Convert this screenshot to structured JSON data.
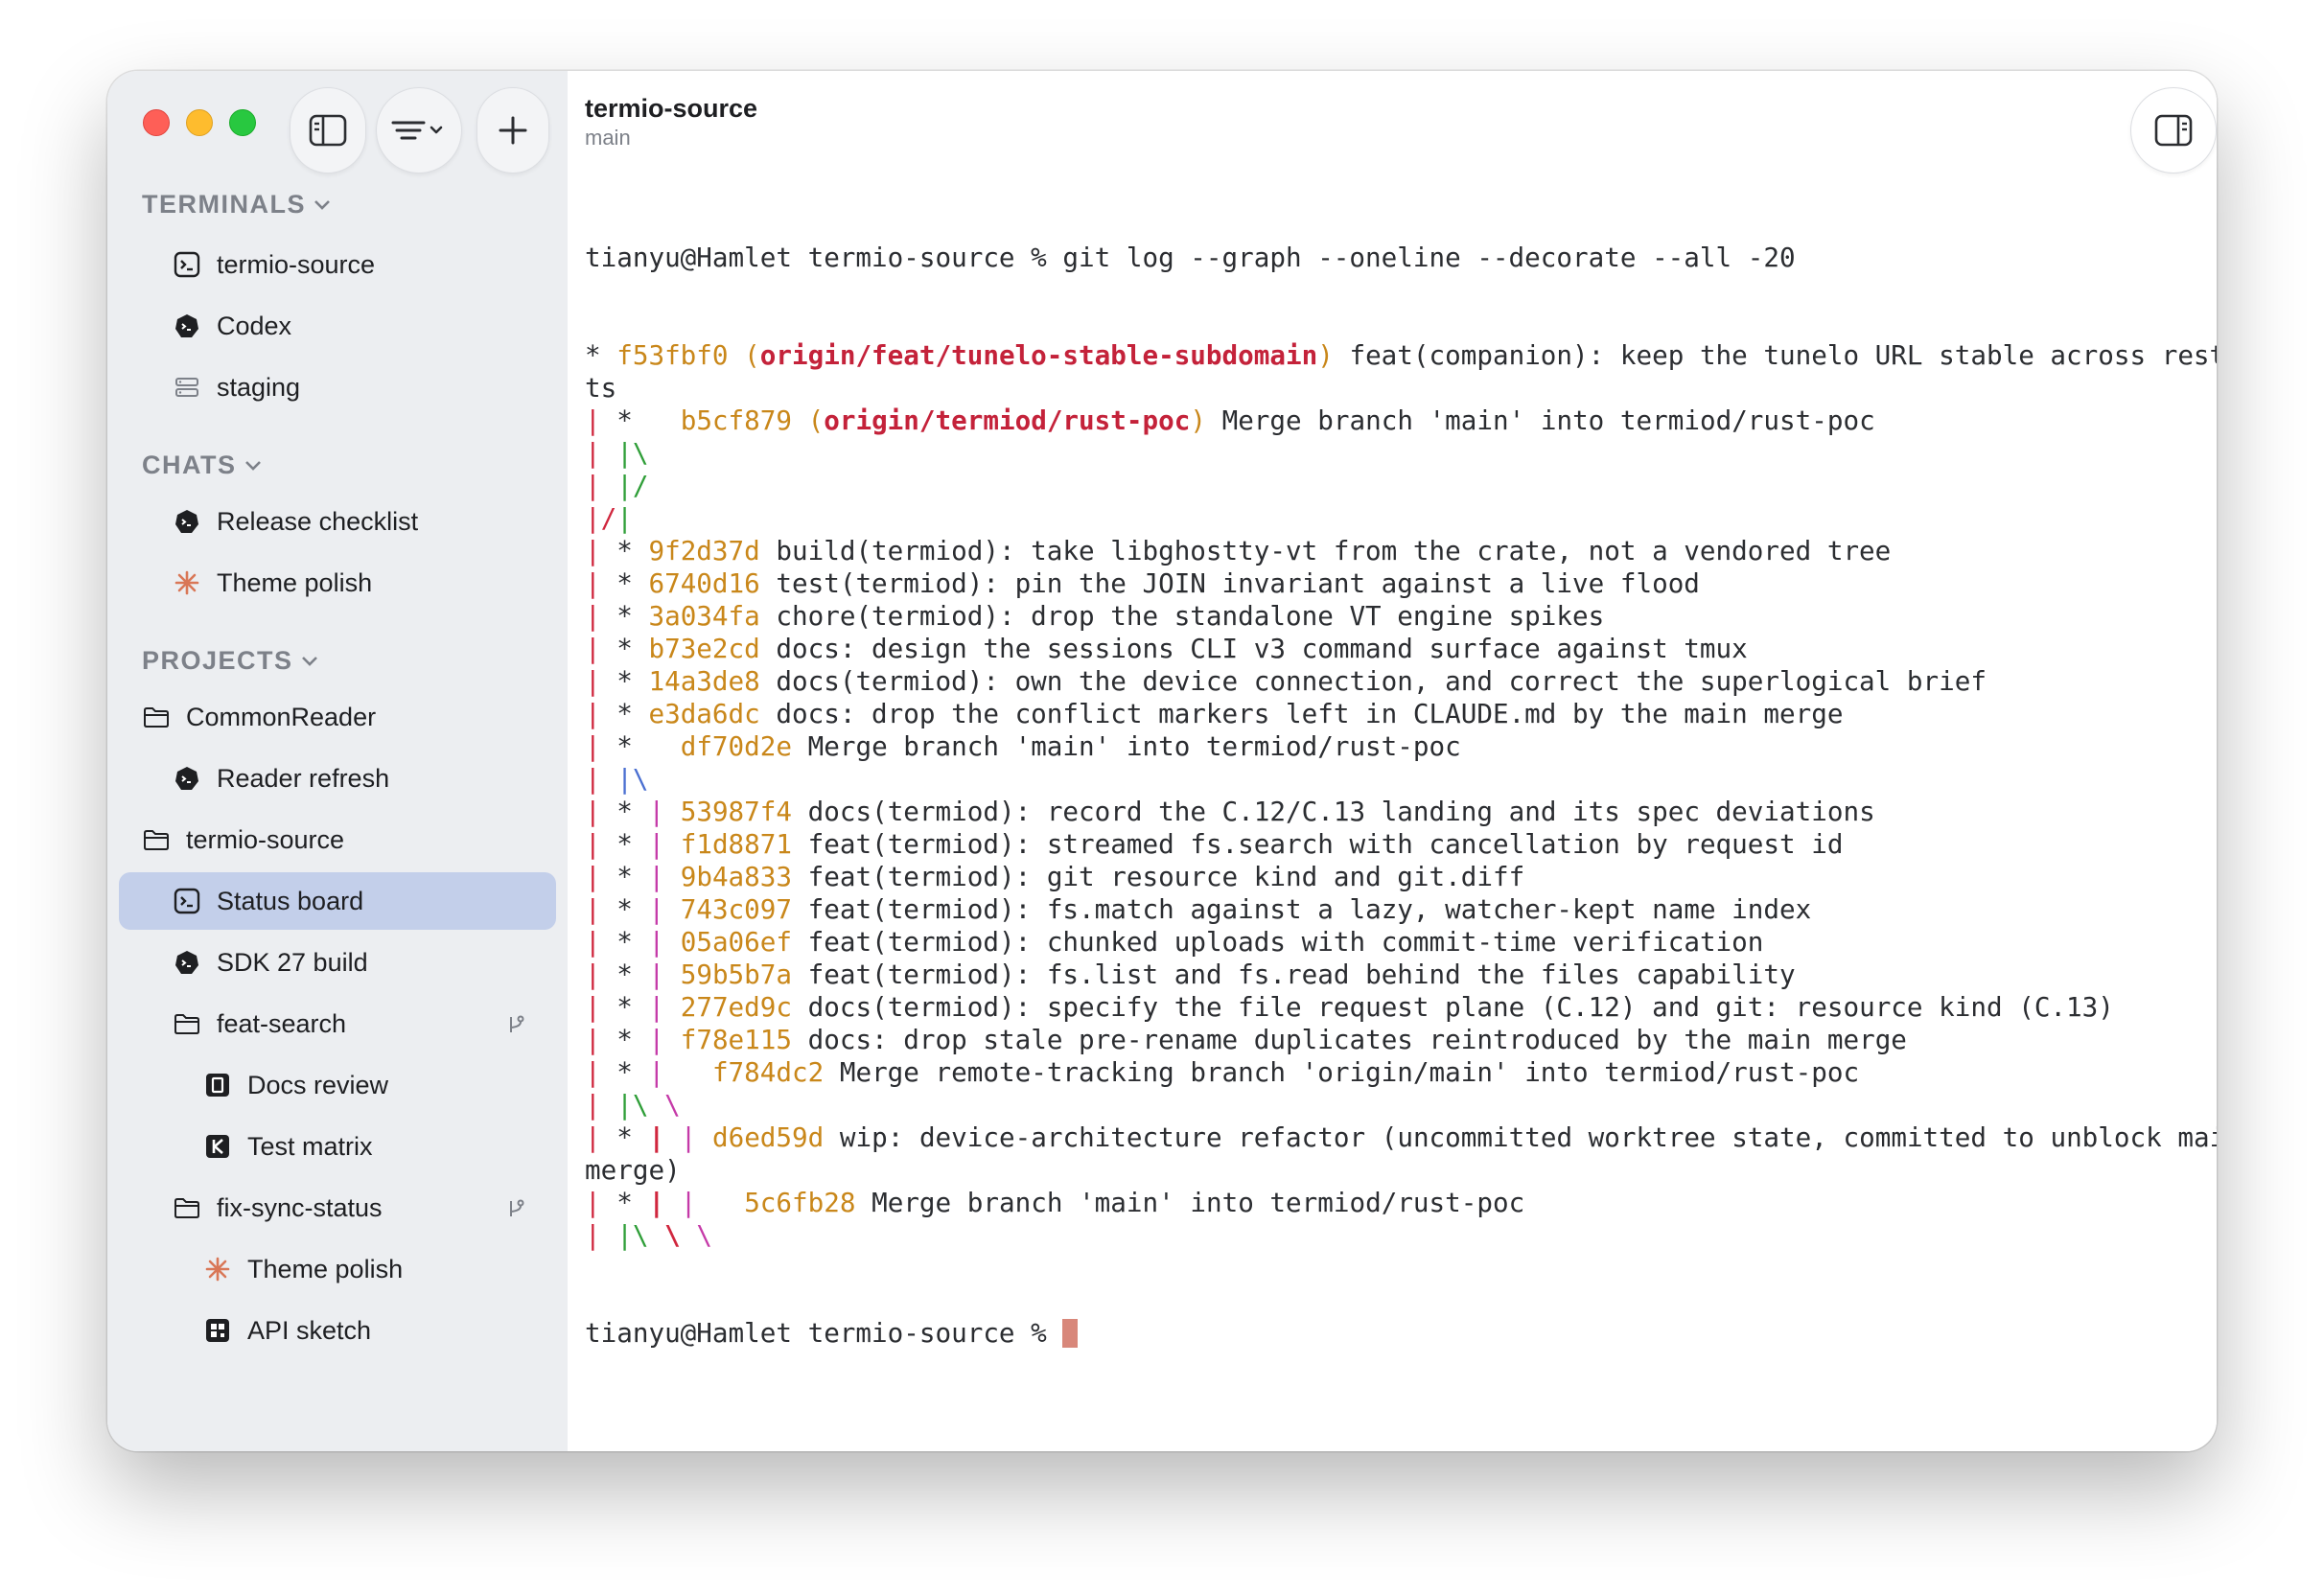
{
  "sidebar": {
    "sections": {
      "terminals": "TERMINALS",
      "chats": "CHATS",
      "projects": "PROJECTS"
    },
    "terminals": [
      "termio-source",
      "Codex",
      "staging"
    ],
    "chats": [
      "Release checklist",
      "Theme polish"
    ],
    "projects": {
      "commonreader": "CommonReader",
      "commonreader_items": [
        "Reader refresh"
      ],
      "termio": "termio-source",
      "termio_items": [
        "Status board",
        "SDK 27 build"
      ],
      "feat_search": "feat-search",
      "feat_search_items": [
        "Docs review",
        "Test matrix"
      ],
      "fix_sync": "fix-sync-status",
      "fix_sync_items": [
        "Theme polish",
        "API sketch"
      ]
    }
  },
  "header": {
    "title": "termio-source",
    "subtitle": "main"
  },
  "terminal": {
    "prompt": "tianyu@Hamlet termio-source % ",
    "command": "git log --graph --oneline --decorate --all -20",
    "lines": [
      [
        {
          "t": "* ",
          "c": ""
        },
        {
          "t": "f53fbf0",
          "c": "hash"
        },
        {
          "t": " (",
          "c": "paren"
        },
        {
          "t": "origin/feat/tunelo-stable-subdomain",
          "c": "ref"
        },
        {
          "t": ")",
          "c": "paren"
        },
        {
          "t": " feat(companion): keep the tunelo URL stable across restar",
          "c": ""
        }
      ],
      [
        {
          "t": "ts",
          "c": ""
        }
      ],
      [
        {
          "t": "|",
          "c": "g1"
        },
        {
          "t": " *   ",
          "c": ""
        },
        {
          "t": "b5cf879",
          "c": "hash"
        },
        {
          "t": " (",
          "c": "paren"
        },
        {
          "t": "origin/termiod/rust-poc",
          "c": "ref"
        },
        {
          "t": ")",
          "c": "paren"
        },
        {
          "t": " Merge branch 'main' into termiod/rust-poc",
          "c": ""
        }
      ],
      [
        {
          "t": "|",
          "c": "g1"
        },
        {
          "t": " ",
          "c": ""
        },
        {
          "t": "|\\",
          "c": "g2"
        }
      ],
      [
        {
          "t": "|",
          "c": "g1"
        },
        {
          "t": " ",
          "c": ""
        },
        {
          "t": "|/",
          "c": "g2"
        }
      ],
      [
        {
          "t": "|/",
          "c": "g1"
        },
        {
          "t": "|",
          "c": "g2"
        }
      ],
      [
        {
          "t": "|",
          "c": "g1"
        },
        {
          "t": " * ",
          "c": ""
        },
        {
          "t": "9f2d37d",
          "c": "hash"
        },
        {
          "t": " build(termiod): take libghostty-vt from the crate, not a vendored tree",
          "c": ""
        }
      ],
      [
        {
          "t": "|",
          "c": "g1"
        },
        {
          "t": " * ",
          "c": ""
        },
        {
          "t": "6740d16",
          "c": "hash"
        },
        {
          "t": " test(termiod): pin the JOIN invariant against a live flood",
          "c": ""
        }
      ],
      [
        {
          "t": "|",
          "c": "g1"
        },
        {
          "t": " * ",
          "c": ""
        },
        {
          "t": "3a034fa",
          "c": "hash"
        },
        {
          "t": " chore(termiod): drop the standalone VT engine spikes",
          "c": ""
        }
      ],
      [
        {
          "t": "|",
          "c": "g1"
        },
        {
          "t": " * ",
          "c": ""
        },
        {
          "t": "b73e2cd",
          "c": "hash"
        },
        {
          "t": " docs: design the sessions CLI v3 command surface against tmux",
          "c": ""
        }
      ],
      [
        {
          "t": "|",
          "c": "g1"
        },
        {
          "t": " * ",
          "c": ""
        },
        {
          "t": "14a3de8",
          "c": "hash"
        },
        {
          "t": " docs(termiod): own the device connection, and correct the superlogical brief",
          "c": ""
        }
      ],
      [
        {
          "t": "|",
          "c": "g1"
        },
        {
          "t": " * ",
          "c": ""
        },
        {
          "t": "e3da6dc",
          "c": "hash"
        },
        {
          "t": " docs: drop the conflict markers left in CLAUDE.md by the main merge",
          "c": ""
        }
      ],
      [
        {
          "t": "|",
          "c": "g1"
        },
        {
          "t": " *   ",
          "c": ""
        },
        {
          "t": "df70d2e",
          "c": "hash"
        },
        {
          "t": " Merge branch 'main' into termiod/rust-poc",
          "c": ""
        }
      ],
      [
        {
          "t": "|",
          "c": "g1"
        },
        {
          "t": " ",
          "c": ""
        },
        {
          "t": "|\\",
          "c": "g4"
        }
      ],
      [
        {
          "t": "|",
          "c": "g1"
        },
        {
          "t": " * ",
          "c": ""
        },
        {
          "t": "|",
          "c": "g5"
        },
        {
          "t": " ",
          "c": ""
        },
        {
          "t": "53987f4",
          "c": "hash"
        },
        {
          "t": " docs(termiod): record the C.12/C.13 landing and its spec deviations",
          "c": ""
        }
      ],
      [
        {
          "t": "|",
          "c": "g1"
        },
        {
          "t": " * ",
          "c": ""
        },
        {
          "t": "|",
          "c": "g5"
        },
        {
          "t": " ",
          "c": ""
        },
        {
          "t": "f1d8871",
          "c": "hash"
        },
        {
          "t": " feat(termiod): streamed fs.search with cancellation by request id",
          "c": ""
        }
      ],
      [
        {
          "t": "|",
          "c": "g1"
        },
        {
          "t": " * ",
          "c": ""
        },
        {
          "t": "|",
          "c": "g5"
        },
        {
          "t": " ",
          "c": ""
        },
        {
          "t": "9b4a833",
          "c": "hash"
        },
        {
          "t": " feat(termiod): git resource kind and git.diff",
          "c": ""
        }
      ],
      [
        {
          "t": "|",
          "c": "g1"
        },
        {
          "t": " * ",
          "c": ""
        },
        {
          "t": "|",
          "c": "g5"
        },
        {
          "t": " ",
          "c": ""
        },
        {
          "t": "743c097",
          "c": "hash"
        },
        {
          "t": " feat(termiod): fs.match against a lazy, watcher-kept name index",
          "c": ""
        }
      ],
      [
        {
          "t": "|",
          "c": "g1"
        },
        {
          "t": " * ",
          "c": ""
        },
        {
          "t": "|",
          "c": "g5"
        },
        {
          "t": " ",
          "c": ""
        },
        {
          "t": "05a06ef",
          "c": "hash"
        },
        {
          "t": " feat(termiod): chunked uploads with commit-time verification",
          "c": ""
        }
      ],
      [
        {
          "t": "|",
          "c": "g1"
        },
        {
          "t": " * ",
          "c": ""
        },
        {
          "t": "|",
          "c": "g5"
        },
        {
          "t": " ",
          "c": ""
        },
        {
          "t": "59b5b7a",
          "c": "hash"
        },
        {
          "t": " feat(termiod): fs.list and fs.read behind the files capability",
          "c": ""
        }
      ],
      [
        {
          "t": "|",
          "c": "g1"
        },
        {
          "t": " * ",
          "c": ""
        },
        {
          "t": "|",
          "c": "g5"
        },
        {
          "t": " ",
          "c": ""
        },
        {
          "t": "277ed9c",
          "c": "hash"
        },
        {
          "t": " docs(termiod): specify the file request plane (C.12) and git: resource kind (C.13)",
          "c": ""
        }
      ],
      [
        {
          "t": "|",
          "c": "g1"
        },
        {
          "t": " * ",
          "c": ""
        },
        {
          "t": "|",
          "c": "g5"
        },
        {
          "t": " ",
          "c": ""
        },
        {
          "t": "f78e115",
          "c": "hash"
        },
        {
          "t": " docs: drop stale pre-rename duplicates reintroduced by the main merge",
          "c": ""
        }
      ],
      [
        {
          "t": "|",
          "c": "g1"
        },
        {
          "t": " * ",
          "c": ""
        },
        {
          "t": "|",
          "c": "g5"
        },
        {
          "t": "   ",
          "c": ""
        },
        {
          "t": "f784dc2",
          "c": "hash"
        },
        {
          "t": " Merge remote-tracking branch 'origin/main' into termiod/rust-poc",
          "c": ""
        }
      ],
      [
        {
          "t": "|",
          "c": "g1"
        },
        {
          "t": " ",
          "c": ""
        },
        {
          "t": "|\\",
          "c": "g2"
        },
        {
          "t": " ",
          "c": ""
        },
        {
          "t": "\\",
          "c": "g5"
        }
      ],
      [
        {
          "t": "|",
          "c": "g1"
        },
        {
          "t": " * ",
          "c": ""
        },
        {
          "t": "|",
          "c": "g6"
        },
        {
          "t": " ",
          "c": ""
        },
        {
          "t": "|",
          "c": "g5"
        },
        {
          "t": " ",
          "c": ""
        },
        {
          "t": "d6ed59d",
          "c": "hash"
        },
        {
          "t": " wip: device-architecture refactor (uncommitted worktree state, committed to unblock main",
          "c": ""
        }
      ],
      [
        {
          "t": "merge)",
          "c": ""
        }
      ],
      [
        {
          "t": "|",
          "c": "g1"
        },
        {
          "t": " * ",
          "c": ""
        },
        {
          "t": "|",
          "c": "g6"
        },
        {
          "t": " ",
          "c": ""
        },
        {
          "t": "|",
          "c": "g5"
        },
        {
          "t": "   ",
          "c": ""
        },
        {
          "t": "5c6fb28",
          "c": "hash"
        },
        {
          "t": " Merge branch 'main' into termiod/rust-poc",
          "c": ""
        }
      ],
      [
        {
          "t": "|",
          "c": "g1"
        },
        {
          "t": " ",
          "c": ""
        },
        {
          "t": "|\\",
          "c": "g2"
        },
        {
          "t": " ",
          "c": ""
        },
        {
          "t": "\\",
          "c": "g6"
        },
        {
          "t": " ",
          "c": ""
        },
        {
          "t": "\\",
          "c": "g5"
        }
      ]
    ],
    "final_prompt": "tianyu@Hamlet termio-source % "
  }
}
